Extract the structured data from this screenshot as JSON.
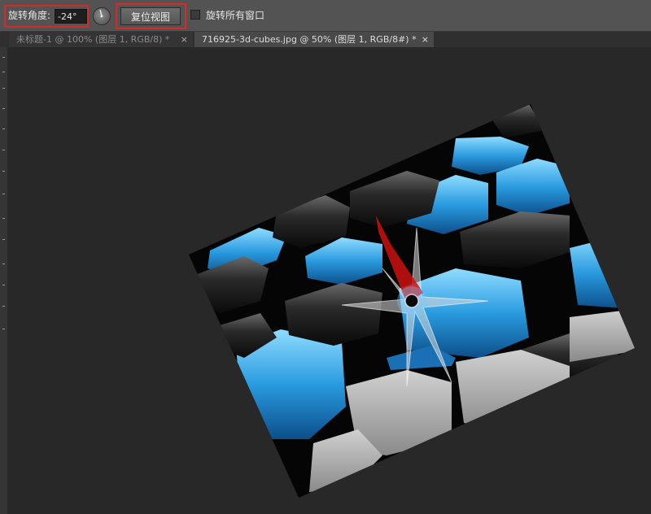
{
  "options_bar": {
    "rotate_angle_label": "旋转角度:",
    "rotate_angle_value": "-24°",
    "reset_view_label": "复位视图",
    "rotate_all_windows_label": "旋转所有窗口",
    "rotate_all_windows_checked": false,
    "highlight_color": "#d42a2a"
  },
  "tabs": [
    {
      "label": "未标题-1 @ 100% (图层 1, RGB/8) *",
      "close": "×",
      "active": false
    },
    {
      "label": "716925-3d-cubes.jpg @ 50% (图层 1, RGB/8#) *",
      "close": "×",
      "active": true
    }
  ],
  "icons": {
    "rotate_dial": "rotate-dial-icon",
    "compass": "compass-rotation-indicator-icon"
  },
  "colors": {
    "cube_blue": "#2a9be0",
    "compass_needle": "#cc1111",
    "workspace": "#282828"
  }
}
